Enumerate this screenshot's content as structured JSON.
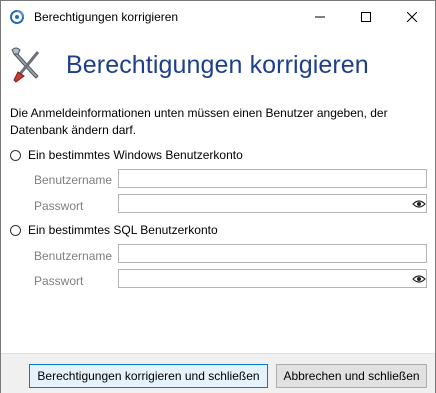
{
  "window": {
    "title": "Berechtigungen korrigieren"
  },
  "header": {
    "title": "Berechtigungen korrigieren"
  },
  "description": "Die Anmeldeinformationen unten müssen einen Benutzer angeben, der Datenbank ändern darf.",
  "windows_account": {
    "radio_label": "Ein bestimmtes Windows Benutzerkonto",
    "username_label": "Benutzername",
    "username_value": "",
    "password_label": "Passwort",
    "password_value": ""
  },
  "sql_account": {
    "radio_label": "Ein bestimmtes SQL Benutzerkonto",
    "username_label": "Benutzername",
    "username_value": "",
    "password_label": "Passwort",
    "password_value": ""
  },
  "buttons": {
    "fix_and_close": "Berechtigungen korrigieren und schließen",
    "cancel_and_close": "Abbrechen und schließen"
  },
  "colors": {
    "heading": "#1e3f8c",
    "accent_border": "#0078d7"
  },
  "icons": {
    "app": "database-icon",
    "header": "tools-icon",
    "minimize": "minimize-icon",
    "maximize": "maximize-icon",
    "close": "close-icon",
    "reveal": "eye-icon"
  }
}
